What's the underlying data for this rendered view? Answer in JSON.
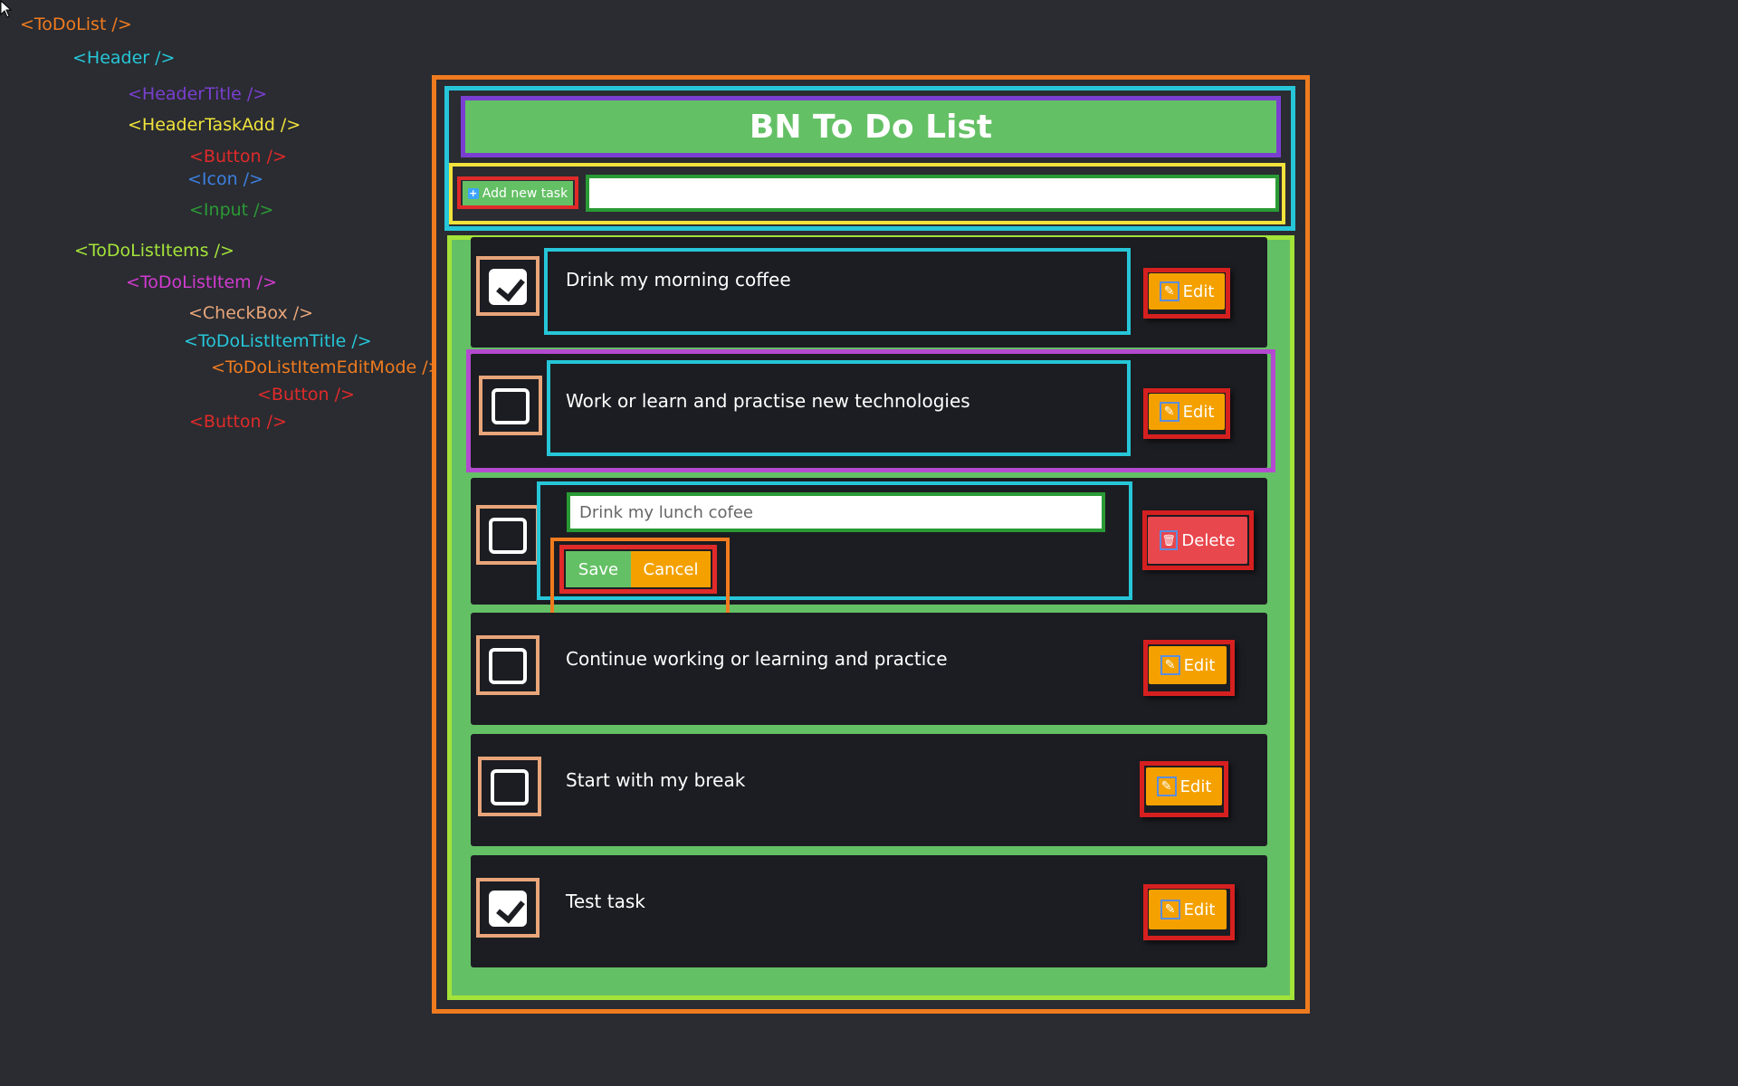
{
  "tree": {
    "todolist": "<ToDoList />",
    "header": "<Header />",
    "header_title": "<HeaderTitle />",
    "header_task_add": "<HeaderTaskAdd />",
    "button_1": "<Button />",
    "icon": "<Icon />",
    "input": "<Input />",
    "todolist_items": "<ToDoListItems />",
    "todolist_item": "<ToDoListItem />",
    "checkbox": "<CheckBox />",
    "todolist_item_title": "<ToDoListItemTitle />",
    "todolist_item_edit_mode": "<ToDoListItemEditMode />",
    "button_2": "<Button />",
    "button_3": "<Button />"
  },
  "header": {
    "title": "BN To Do List",
    "add_button_label": "Add new task",
    "add_input_value": ""
  },
  "items": [
    {
      "title": "Drink my morning coffee",
      "checked": true,
      "action": "Edit"
    },
    {
      "title": "Work or learn and practise new technologies",
      "checked": false,
      "action": "Edit"
    },
    {
      "edit_value": "Drink my lunch cofee",
      "checked": false,
      "action": "Delete",
      "save_label": "Save",
      "cancel_label": "Cancel"
    },
    {
      "title": "Continue working or learning and practice",
      "checked": false,
      "action": "Edit"
    },
    {
      "title": "Start with my break",
      "checked": false,
      "action": "Edit"
    },
    {
      "title": "Test task",
      "checked": true,
      "action": "Edit"
    }
  ],
  "colors": {
    "background": "#2a2c31",
    "green": "#64c065",
    "orange": "#f4a100",
    "red": "#e8474d"
  }
}
